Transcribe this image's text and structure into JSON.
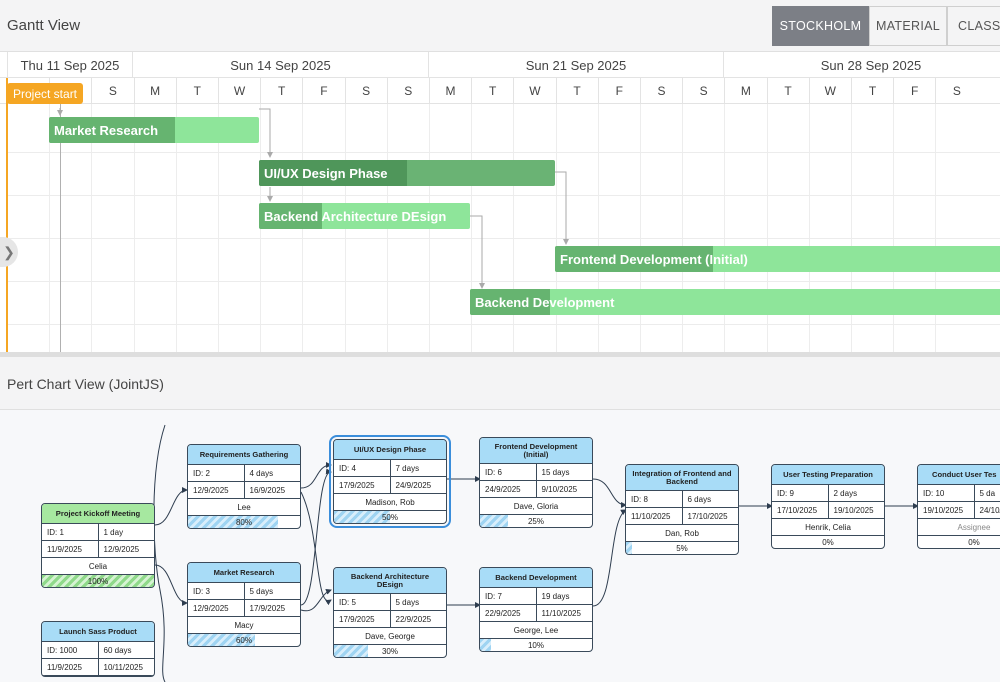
{
  "gantt": {
    "title": "Gantt View",
    "themes": [
      "STOCKHOLM",
      "MATERIAL",
      "CLASSIC"
    ],
    "active_theme": "STOCKHOLM",
    "weeks": [
      "Thu 11 Sep 2025",
      "Sun 14 Sep 2025",
      "Sun 21 Sep 2025",
      "Sun 28 Sep 2025"
    ],
    "days": [
      "F",
      "S",
      "S",
      "M",
      "T",
      "W",
      "T",
      "F",
      "S",
      "S",
      "M",
      "T",
      "W",
      "T",
      "F",
      "S",
      "S",
      "M",
      "T",
      "W",
      "T",
      "F",
      "S"
    ],
    "milestone": "Project start",
    "collapse_icon": "chevron-right-icon",
    "tasks": [
      {
        "name": "Market Research",
        "progress": 0.6
      },
      {
        "name": "UI/UX Design Phase",
        "progress": 0.5
      },
      {
        "name": "Backend Architecture DEsign",
        "progress": 0.3
      },
      {
        "name": "Frontend Development (Initial)",
        "progress": 0.25
      },
      {
        "name": "Backend Development",
        "progress": 0.1
      }
    ],
    "colors": {
      "bar": "#8ee59a",
      "bar_progress": "#66b470",
      "milestone": "#f5a623",
      "active_theme": "#7c7f86"
    }
  },
  "pert": {
    "title": "Pert Chart View (JointJS)",
    "colors": {
      "header_blue": "#a8dcf7",
      "header_green": "#a6e8a0",
      "selected": "#3b8edb"
    },
    "cards": {
      "kickoff": {
        "title": "Project Kickoff Meeting",
        "id": "ID: 1",
        "duration": "1 day",
        "start": "11/9/2025",
        "end": "12/9/2025",
        "resources": "Celia",
        "progress": "100%",
        "progress_value": 1.0
      },
      "req": {
        "title": "Requirements Gathering",
        "id": "ID: 2",
        "duration": "4 days",
        "start": "12/9/2025",
        "end": "16/9/2025",
        "resources": "Lee",
        "progress": "80%",
        "progress_value": 0.8
      },
      "market": {
        "title": "Market Research",
        "id": "ID: 3",
        "duration": "5 days",
        "start": "12/9/2025",
        "end": "17/9/2025",
        "resources": "Macy",
        "progress": "60%",
        "progress_value": 0.6
      },
      "uiux": {
        "title": "UI/UX Design Phase",
        "id": "ID: 4",
        "duration": "7 days",
        "start": "17/9/2025",
        "end": "24/9/2025",
        "resources": "Madison, Rob",
        "progress": "50%",
        "progress_value": 0.5
      },
      "backarch": {
        "title": "Backend Architecture DEsign",
        "id": "ID: 5",
        "duration": "5 days",
        "start": "17/9/2025",
        "end": "22/9/2025",
        "resources": "Dave, George",
        "progress": "30%",
        "progress_value": 0.3
      },
      "frontdev": {
        "title": "Frontend Development (Initial)",
        "id": "ID: 6",
        "duration": "15 days",
        "start": "24/9/2025",
        "end": "9/10/2025",
        "resources": "Dave, Gloria",
        "progress": "25%",
        "progress_value": 0.25
      },
      "backdev": {
        "title": "Backend Development",
        "id": "ID: 7",
        "duration": "19 days",
        "start": "22/9/2025",
        "end": "11/10/2025",
        "resources": "George, Lee",
        "progress": "10%",
        "progress_value": 0.1
      },
      "integ": {
        "title": "Integration of Frontend and Backend",
        "id": "ID: 8",
        "duration": "6 days",
        "start": "11/10/2025",
        "end": "17/10/2025",
        "resources": "Dan, Rob",
        "progress": "5%",
        "progress_value": 0.05
      },
      "usertest": {
        "title": "User Testing Preparation",
        "id": "ID: 9",
        "duration": "2 days",
        "start": "17/10/2025",
        "end": "19/10/2025",
        "resources": "Henrik, Celia",
        "progress": "0%",
        "progress_value": 0
      },
      "conduct": {
        "title": "Conduct User Tes",
        "id": "ID: 10",
        "duration": "5 da",
        "start": "19/10/2025",
        "end": "24/10/",
        "resources": "Assignee",
        "progress": "0%",
        "progress_value": 0
      },
      "sass": {
        "title": "Launch Sass Product",
        "id": "ID: 1000",
        "duration": "60 days",
        "start": "11/9/2025",
        "end": "10/11/2025",
        "resources": "",
        "progress": "",
        "progress_value": 0
      }
    }
  }
}
